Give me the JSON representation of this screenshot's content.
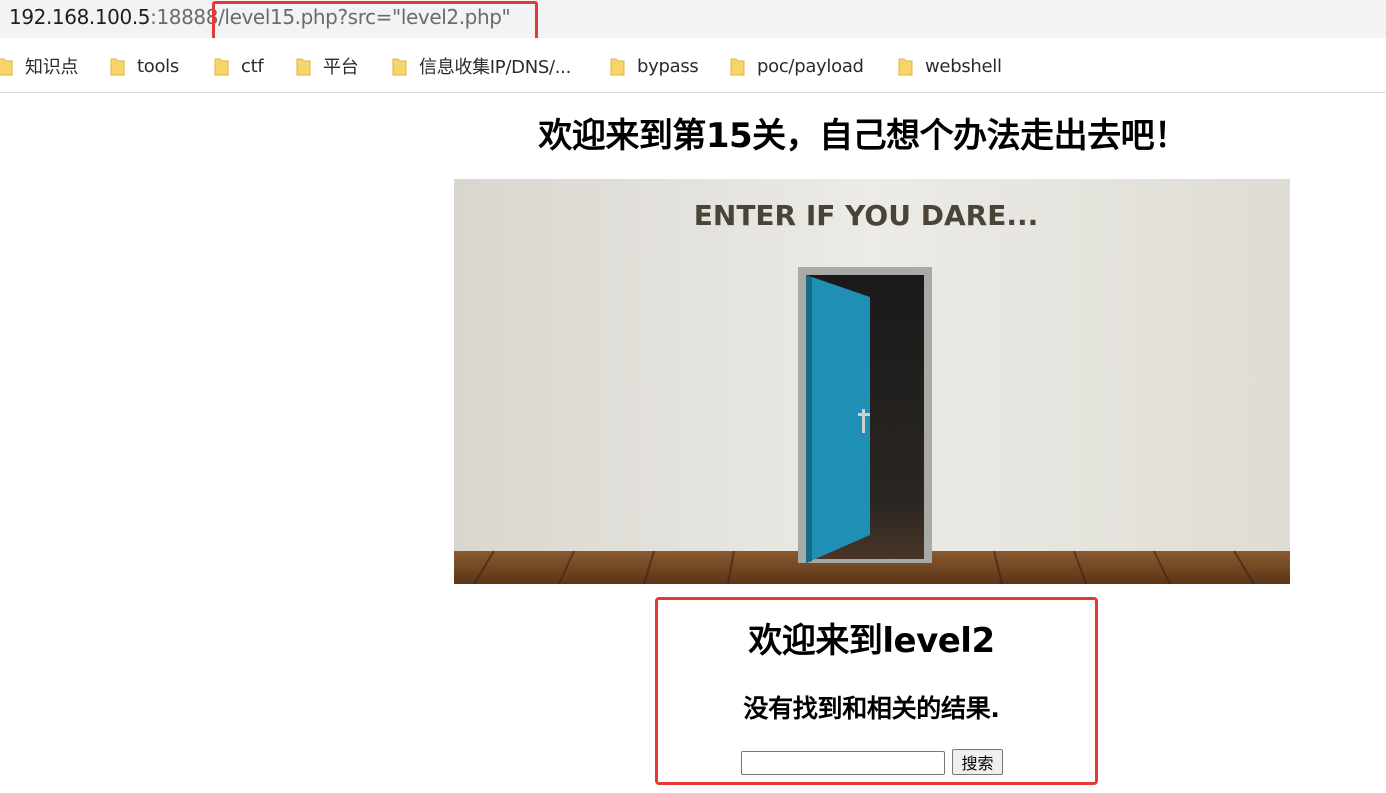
{
  "address_bar": {
    "host": "192.168.100.5",
    "port_part": ":18888",
    "path": "/level15.php?src=\"level2.php\""
  },
  "bookmarks": [
    {
      "label": "知识点",
      "icon": "folder-icon"
    },
    {
      "label": "tools",
      "icon": "folder-icon"
    },
    {
      "label": "ctf",
      "icon": "folder-icon"
    },
    {
      "label": "平台",
      "icon": "folder-icon"
    },
    {
      "label": "信息收集IP/DNS/...",
      "icon": "folder-icon"
    },
    {
      "label": "bypass",
      "icon": "folder-icon"
    },
    {
      "label": "poc/payload",
      "icon": "folder-icon"
    },
    {
      "label": "webshell",
      "icon": "folder-icon"
    }
  ],
  "page": {
    "title": "欢迎来到第15关，自己想个办法走出去吧！",
    "image_text": "ENTER IF YOU DARE..."
  },
  "included_frame": {
    "title": "欢迎来到level2",
    "message": "没有找到和相关的结果.",
    "search_value": "",
    "search_button": "搜索"
  },
  "colors": {
    "highlight_box": "#e53935",
    "door": "#1f8fb5",
    "folder": "#f7d56a"
  }
}
